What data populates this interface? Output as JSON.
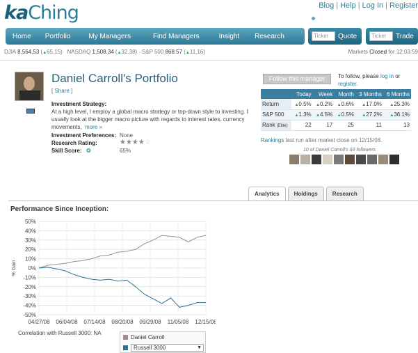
{
  "brand": {
    "logo_a": "ka",
    "logo_b": "Ching"
  },
  "top_links": [
    "Blog",
    "Help",
    "Log In",
    "Register"
  ],
  "nav": [
    "Home",
    "Portfolio",
    "My Managers",
    "Find Managers",
    "Insight",
    "Research"
  ],
  "quote_box": {
    "placeholder": "Ticker",
    "button": "Quote"
  },
  "trade_box": {
    "placeholder": "Ticker",
    "button": "Trade"
  },
  "ticker": [
    {
      "name": "DJIA",
      "value": "8,564.53",
      "change": "65.15"
    },
    {
      "name": "NASDAQ",
      "value": "1,508.34",
      "change": "32.38"
    },
    {
      "name": "S&P 500",
      "value": "868.57",
      "change": "11.16"
    }
  ],
  "market_status": {
    "prefix": "Markets",
    "state": "Closed",
    "suffix": "for 12:03:59"
  },
  "profile": {
    "name": "Daniel Carroll's Portfolio",
    "share": "[ Share ]",
    "strategy_label": "Investment Strategy:",
    "strategy_text": "At a high level, I employ a global macro strategy or top-down style to investing. I usually look at the bigger macro picture with regards to interest rates, currency movements,",
    "more": "more »",
    "preferences_label": "Investment Preferences:",
    "preferences_value": "None",
    "rating_label": "Research Rating:",
    "rating_stars": 4,
    "skill_label": "Skill Score:",
    "skill_value": "65%"
  },
  "follow": {
    "button": "Follow this manager",
    "text": "To follow, please",
    "login": "log in",
    "or": "or",
    "register": "register."
  },
  "performance_table": {
    "headers": [
      "",
      "Today",
      "Week",
      "Month",
      "3 Months",
      "6 Months"
    ],
    "rows": [
      {
        "label": "Return",
        "values": [
          "0.5%",
          "0.2%",
          "0.6%",
          "17.0%",
          "25.3%"
        ]
      },
      {
        "label": "S&P 500",
        "values": [
          "1.3%",
          "4.5%",
          "0.5%",
          "27.2%",
          "36.1%"
        ]
      },
      {
        "label": "Rank",
        "sub": "(Elite)",
        "values": [
          "22",
          "17",
          "25",
          "11",
          "13"
        ]
      }
    ]
  },
  "rankings": {
    "link": "Rankings",
    "text": "last run after market close on 12/15/08."
  },
  "followers_text": "10 of Daniel Carroll's 83 followers",
  "tabs": [
    "Analytics",
    "Holdings",
    "Research"
  ],
  "chart_title": "Performance Since Inception:",
  "correlation": "Correlation with Russell 3000: NA",
  "legend": {
    "series1": "Daniel Carroll",
    "series2": "Russell 3000"
  },
  "colors": {
    "accent": "#2a7d94",
    "series1": "#a48c84",
    "series2": "#2e6f8e"
  },
  "chart_data": {
    "type": "line",
    "xlabel": "",
    "ylabel": "% Gain",
    "ylim": [
      -50,
      50
    ],
    "yticks": [
      "50%",
      "40%",
      "30%",
      "20%",
      "10%",
      "0%",
      "-10%",
      "-20%",
      "-30%",
      "-40%",
      "-50%"
    ],
    "xticks": [
      "04/27/08",
      "06/04/08",
      "07/14/08",
      "08/20/08",
      "09/29/08",
      "11/05/08",
      "12/15/08"
    ],
    "x": [
      "04/27/08",
      "05/10/08",
      "05/23/08",
      "06/04/08",
      "06/17/08",
      "06/30/08",
      "07/14/08",
      "07/26/08",
      "08/08/08",
      "08/20/08",
      "09/02/08",
      "09/15/08",
      "09/29/08",
      "10/11/08",
      "10/23/08",
      "11/05/08",
      "11/18/08",
      "12/01/08",
      "12/08/08",
      "12/15/08"
    ],
    "series": [
      {
        "name": "Daniel Carroll",
        "values": [
          0,
          3,
          4,
          5,
          7,
          8,
          10,
          13,
          14,
          17,
          18,
          20,
          26,
          30,
          35,
          34,
          33,
          28,
          33,
          35
        ]
      },
      {
        "name": "Russell 3000",
        "values": [
          0,
          1,
          -1,
          -3,
          -7,
          -10,
          -12,
          -13,
          -12,
          -14,
          -13,
          -20,
          -28,
          -33,
          -38,
          -32,
          -42,
          -40,
          -37,
          -37
        ]
      }
    ]
  }
}
